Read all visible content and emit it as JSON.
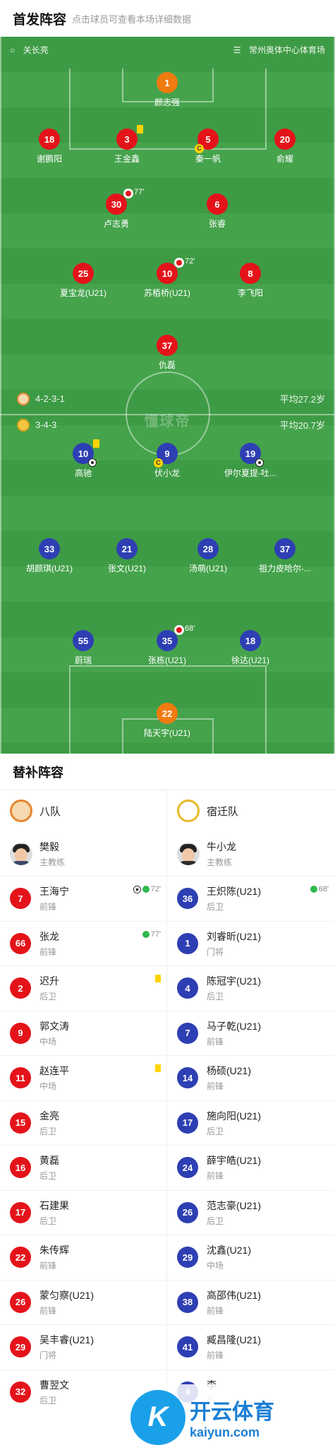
{
  "header": {
    "title": "首发阵容",
    "subtitle": "点击球员可查看本场详细数据"
  },
  "pitch": {
    "referee": "关长亮",
    "stadium": "常州奥体中心体育场",
    "watermark": "懂球帝",
    "home_formation": "4-2-3-1",
    "home_avg_age": "平均27.2岁",
    "away_formation": "3-4-3",
    "away_avg_age": "平均20.7岁",
    "home_players": [
      {
        "num": "1",
        "name": "颜志强"
      },
      {
        "num": "18",
        "name": "谢鹏阳"
      },
      {
        "num": "3",
        "name": "王金鑫"
      },
      {
        "num": "5",
        "name": "秦一帆"
      },
      {
        "num": "20",
        "name": "俞耀"
      },
      {
        "num": "30",
        "name": "卢志勇",
        "sub_min": "77'"
      },
      {
        "num": "6",
        "name": "张睿"
      },
      {
        "num": "25",
        "name": "夏宝龙(U21)"
      },
      {
        "num": "10",
        "name": "苏栢桥(U21)",
        "sub_min": "72'"
      },
      {
        "num": "8",
        "name": "李飞阳"
      },
      {
        "num": "37",
        "name": "仇磊"
      }
    ],
    "away_players": [
      {
        "num": "10",
        "name": "高驰"
      },
      {
        "num": "9",
        "name": "伏小龙"
      },
      {
        "num": "19",
        "name": "伊尔夏提-吐..."
      },
      {
        "num": "33",
        "name": "胡颜琪(U21)"
      },
      {
        "num": "21",
        "name": "张文(U21)"
      },
      {
        "num": "28",
        "name": "汤萌(U21)"
      },
      {
        "num": "37",
        "name": "祖力皮哈尔-..."
      },
      {
        "num": "55",
        "name": "蔚瑞"
      },
      {
        "num": "35",
        "name": "张栋(U21)",
        "sub_min": "68'"
      },
      {
        "num": "18",
        "name": "徐达(U21)"
      },
      {
        "num": "22",
        "name": "陆天宇(U21)"
      }
    ],
    "captain_glyph": "C"
  },
  "bench": {
    "title": "替补阵容",
    "home": {
      "team": "八队",
      "coach": {
        "name": "樊毅",
        "role": "主教练"
      },
      "players": [
        {
          "num": "7",
          "name": "王海宁",
          "pos": "前锋",
          "note": "72'"
        },
        {
          "num": "66",
          "name": "张龙",
          "pos": "前锋",
          "note": "77'"
        },
        {
          "num": "2",
          "name": "迟升",
          "pos": "后卫"
        },
        {
          "num": "9",
          "name": "郭文涛",
          "pos": "中场"
        },
        {
          "num": "11",
          "name": "赵连平",
          "pos": "中场"
        },
        {
          "num": "15",
          "name": "金亮",
          "pos": "后卫"
        },
        {
          "num": "16",
          "name": "黄磊",
          "pos": "后卫"
        },
        {
          "num": "17",
          "name": "石建果",
          "pos": "后卫"
        },
        {
          "num": "22",
          "name": "朱传辉",
          "pos": "前锋"
        },
        {
          "num": "26",
          "name": "蒙匀察(U21)",
          "pos": "前锋"
        },
        {
          "num": "29",
          "name": "吴丰睿(U21)",
          "pos": "门将"
        },
        {
          "num": "32",
          "name": "曹翌文",
          "pos": "后卫"
        }
      ]
    },
    "away": {
      "team": "宿迁队",
      "coach": {
        "name": "牛小龙",
        "role": "主教练"
      },
      "players": [
        {
          "num": "36",
          "name": "王炽陈(U21)",
          "pos": "后卫",
          "note": "68'"
        },
        {
          "num": "1",
          "name": "刘睿昕(U21)",
          "pos": "门将"
        },
        {
          "num": "4",
          "name": "陈冠宇(U21)",
          "pos": "后卫"
        },
        {
          "num": "7",
          "name": "马子乾(U21)",
          "pos": "前锋"
        },
        {
          "num": "14",
          "name": "杨硕(U21)",
          "pos": "前锋"
        },
        {
          "num": "17",
          "name": "施向阳(U21)",
          "pos": "后卫"
        },
        {
          "num": "24",
          "name": "薛宇皓(U21)",
          "pos": "前锋"
        },
        {
          "num": "26",
          "name": "范志豪(U21)",
          "pos": "后卫"
        },
        {
          "num": "29",
          "name": "沈鑫(U21)",
          "pos": "中场"
        },
        {
          "num": "38",
          "name": "高邵伟(U21)",
          "pos": "前锋"
        },
        {
          "num": "41",
          "name": "臧昌隆(U21)",
          "pos": "前锋"
        },
        {
          "num": "4",
          "name": "李",
          "pos": "前"
        }
      ]
    }
  },
  "footer": {
    "brand": "开云体育",
    "domain": "kaiyun.com",
    "mark": "K"
  },
  "colors": {
    "pitch": "#3e9b45",
    "home": "#e4131a",
    "away": "#2e3fb3",
    "keeper_home": "#f07b10",
    "yellow": "#ffd400"
  }
}
